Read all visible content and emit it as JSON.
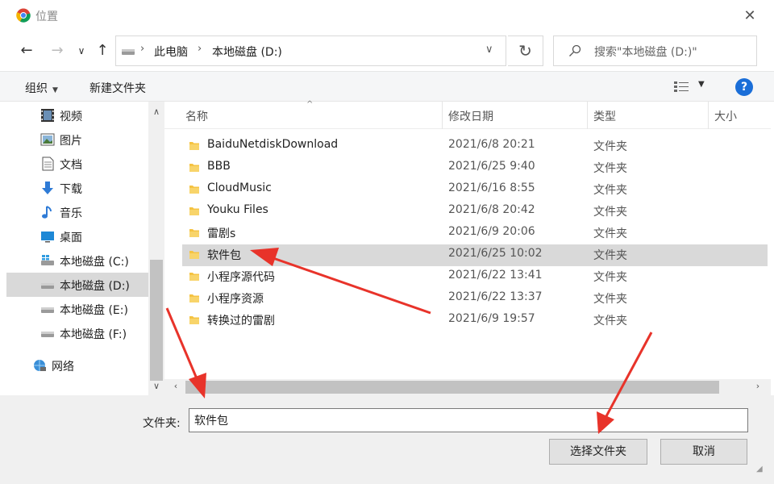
{
  "window": {
    "title": "位置"
  },
  "address": {
    "crumbs": [
      "此电脑",
      "本地磁盘 (D:)"
    ],
    "search_placeholder": "搜索\"本地磁盘 (D:)\""
  },
  "toolbar": {
    "organize": "组织",
    "new_folder": "新建文件夹"
  },
  "nav": {
    "items": [
      {
        "label": "视频",
        "icon": "video-icon"
      },
      {
        "label": "图片",
        "icon": "picture-icon"
      },
      {
        "label": "文档",
        "icon": "document-icon"
      },
      {
        "label": "下载",
        "icon": "download-icon"
      },
      {
        "label": "音乐",
        "icon": "music-icon"
      },
      {
        "label": "桌面",
        "icon": "desktop-icon"
      },
      {
        "label": "本地磁盘 (C:)",
        "icon": "system-drive-icon"
      },
      {
        "label": "本地磁盘 (D:)",
        "icon": "drive-icon",
        "selected": true
      },
      {
        "label": "本地磁盘 (E:)",
        "icon": "drive-icon"
      },
      {
        "label": "本地磁盘 (F:)",
        "icon": "drive-icon"
      },
      {
        "label": "网络",
        "icon": "network-icon"
      }
    ]
  },
  "columns": {
    "name": "名称",
    "date": "修改日期",
    "type": "类型",
    "size": "大小"
  },
  "files": [
    {
      "name": "BaiduNetdiskDownload",
      "date": "2021/6/8 20:21",
      "type": "文件夹"
    },
    {
      "name": "BBB",
      "date": "2021/6/25 9:40",
      "type": "文件夹"
    },
    {
      "name": "CloudMusic",
      "date": "2021/6/16 8:55",
      "type": "文件夹"
    },
    {
      "name": "Youku Files",
      "date": "2021/6/8 20:42",
      "type": "文件夹"
    },
    {
      "name": "雷剧s",
      "date": "2021/6/9 20:06",
      "type": "文件夹"
    },
    {
      "name": "软件包",
      "date": "2021/6/25 10:02",
      "type": "文件夹",
      "selected": true
    },
    {
      "name": "小程序源代码",
      "date": "2021/6/22 13:41",
      "type": "文件夹"
    },
    {
      "name": "小程序资源",
      "date": "2021/6/22 13:37",
      "type": "文件夹"
    },
    {
      "name": "转换过的雷剧",
      "date": "2021/6/9 19:57",
      "type": "文件夹"
    }
  ],
  "bottom": {
    "folder_label": "文件夹:",
    "folder_value": "软件包",
    "select_button": "选择文件夹",
    "cancel_button": "取消"
  },
  "colors": {
    "accent": "#1a6ed8",
    "selection": "#d9d9d9",
    "folder": "#f5c342",
    "annotation": "#e8332a"
  }
}
